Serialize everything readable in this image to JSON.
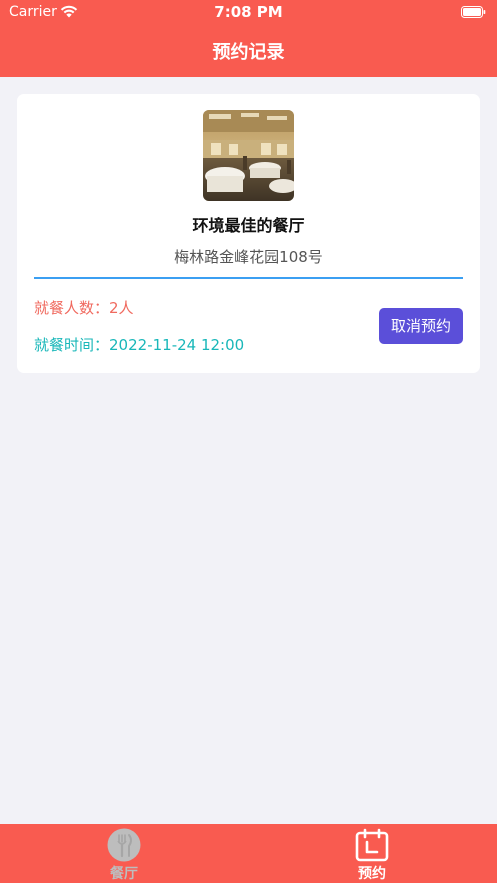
{
  "status_bar": {
    "carrier": "Carrier",
    "time": "7:08 PM"
  },
  "nav": {
    "title": "预约记录"
  },
  "reservation": {
    "restaurant_name": "环境最佳的餐厅",
    "address": "梅林路金峰花园108号",
    "people_label": "就餐人数：",
    "people_value": "2人",
    "time_label": "就餐时间：",
    "time_value": "2022-11-24 12:00",
    "cancel_label": "取消预约",
    "thumbnail_alt": "restaurant-dining-room-photo"
  },
  "tabbar": {
    "tabs": [
      {
        "label": "餐厅",
        "icon": "restaurant-fork-icon",
        "active": false
      },
      {
        "label": "预约",
        "icon": "calendar-icon",
        "active": true
      }
    ]
  },
  "colors": {
    "brand": "#f95b50",
    "people_text": "#f06a5f",
    "time_text": "#19b7b9",
    "cancel_button": "#5b4fd9",
    "divider": "#3b9ff2",
    "background": "#f2f2f7",
    "inactive_tab": "#bdbdbd"
  }
}
